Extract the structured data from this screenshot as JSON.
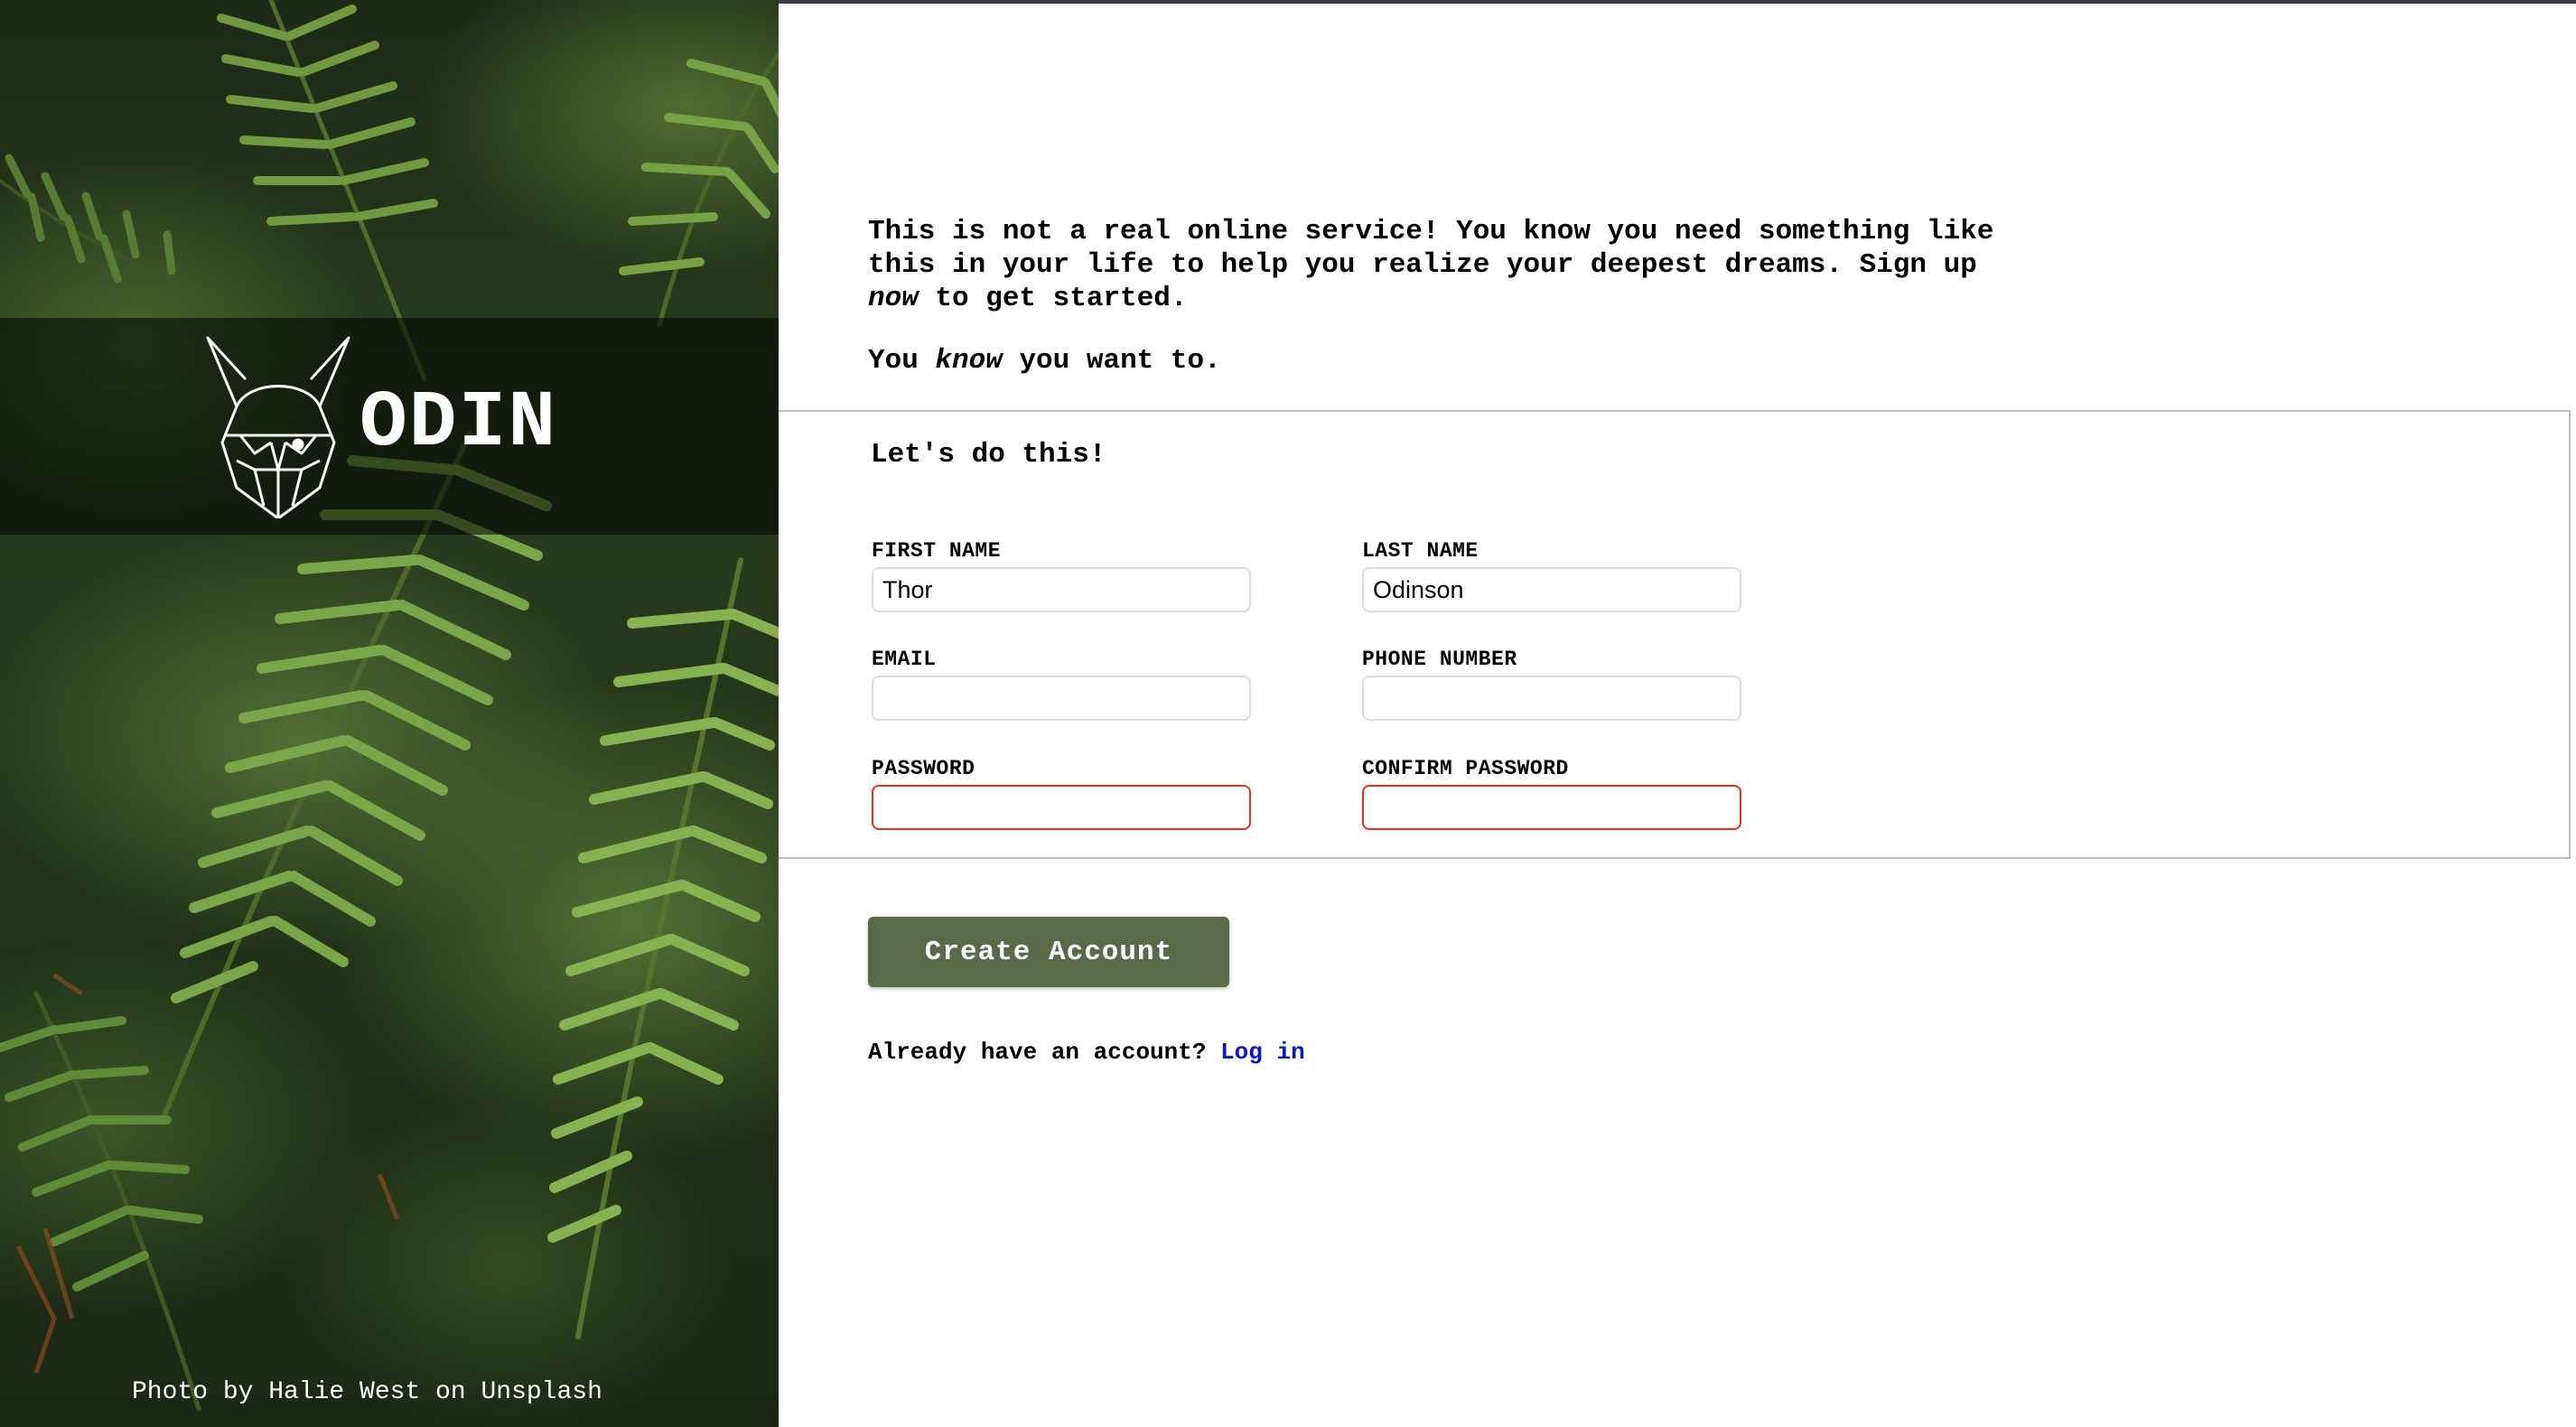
{
  "brand": {
    "logo_text": "ODIN",
    "photo_credit": "Photo by Halie West on Unsplash"
  },
  "intro": {
    "line1_before": "This is not a real online service! You know you need something like this in your life to help you realize your deepest dreams. Sign up ",
    "line1_em": "now",
    "line1_after": " to get started.",
    "line2_before": "You ",
    "line2_em": "know",
    "line2_after": " you want to."
  },
  "form": {
    "title": "Let's do this!",
    "first_name": {
      "label": "FIRST NAME",
      "value": "Thor"
    },
    "last_name": {
      "label": "LAST NAME",
      "value": "Odinson"
    },
    "email": {
      "label": "EMAIL",
      "value": ""
    },
    "phone": {
      "label": "PHONE NUMBER",
      "value": ""
    },
    "password": {
      "label": "PASSWORD",
      "value": ""
    },
    "confirm_password": {
      "label": "CONFIRM PASSWORD",
      "value": ""
    }
  },
  "actions": {
    "create_account_label": "Create Account",
    "login_prompt": "Already have an account?",
    "login_link": "Log in"
  },
  "colors": {
    "button_bg": "#596a48",
    "invalid_border": "#e0321e",
    "link": "#0b17c5"
  }
}
